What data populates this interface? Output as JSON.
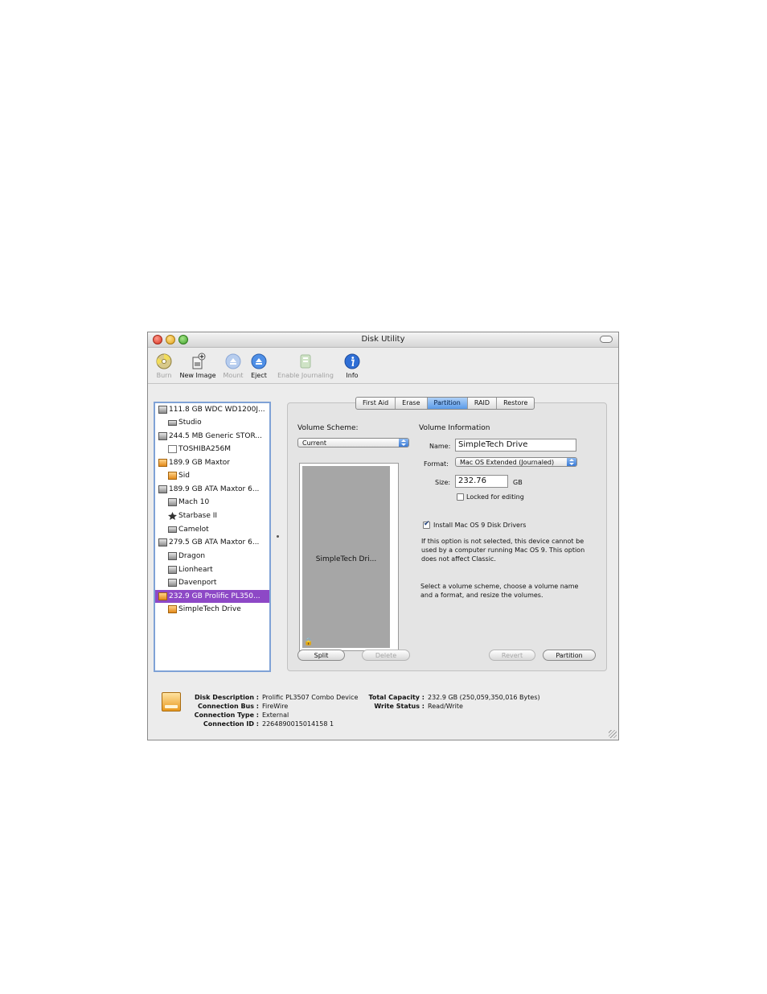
{
  "window": {
    "title": "Disk Utility"
  },
  "toolbar": {
    "burn": "Burn",
    "new_image": "New Image",
    "mount": "Mount",
    "eject": "Eject",
    "enable_journaling": "Enable Journaling",
    "info": "Info"
  },
  "sidebar": {
    "items": [
      {
        "label": "111.8 GB WDC WD1200J..."
      },
      {
        "label": "Studio"
      },
      {
        "label": "244.5 MB Generic STOR..."
      },
      {
        "label": "TOSHIBA256M"
      },
      {
        "label": "189.9 GB Maxtor"
      },
      {
        "label": "Sid"
      },
      {
        "label": "189.9 GB ATA Maxtor 6..."
      },
      {
        "label": "Mach 10"
      },
      {
        "label": "Starbase II"
      },
      {
        "label": "Camelot"
      },
      {
        "label": "279.5 GB ATA Maxtor 6..."
      },
      {
        "label": "Dragon"
      },
      {
        "label": "Lionheart"
      },
      {
        "label": "Davenport"
      },
      {
        "label": "232.9 GB Prolific PL350..."
      },
      {
        "label": "SimpleTech Drive"
      }
    ]
  },
  "tabs": [
    "First Aid",
    "Erase",
    "Partition",
    "RAID",
    "Restore"
  ],
  "partition": {
    "scheme_label": "Volume Scheme:",
    "scheme_value": "Current",
    "volume_name_in_map": "SimpleTech Dri...",
    "info_label": "Volume Information",
    "name_label": "Name:",
    "name_value": "SimpleTech Drive",
    "format_label": "Format:",
    "format_value": "Mac OS Extended (Journaled)",
    "size_label": "Size:",
    "size_value": "232.76",
    "size_unit": "GB",
    "locked_label": "Locked for editing",
    "install_label": "Install Mac OS 9 Disk Drivers",
    "install_desc": "If this option is not selected, this device cannot be used by a computer running Mac OS 9.  This option does not affect Classic.",
    "hint": "Select a volume scheme, choose a volume name and a format, and resize the volumes.",
    "split": "Split",
    "delete": "Delete",
    "revert": "Revert",
    "partition": "Partition"
  },
  "disk_info": {
    "description_key": "Disk Description :",
    "description_val": "Prolific PL3507 Combo Device",
    "bus_key": "Connection Bus :",
    "bus_val": "FireWire",
    "type_key": "Connection Type :",
    "type_val": "External",
    "id_key": "Connection ID :",
    "id_val": "2264890015014158 1",
    "capacity_key": "Total Capacity :",
    "capacity_val": "232.9 GB (250,059,350,016 Bytes)",
    "write_key": "Write Status :",
    "write_val": "Read/Write"
  }
}
